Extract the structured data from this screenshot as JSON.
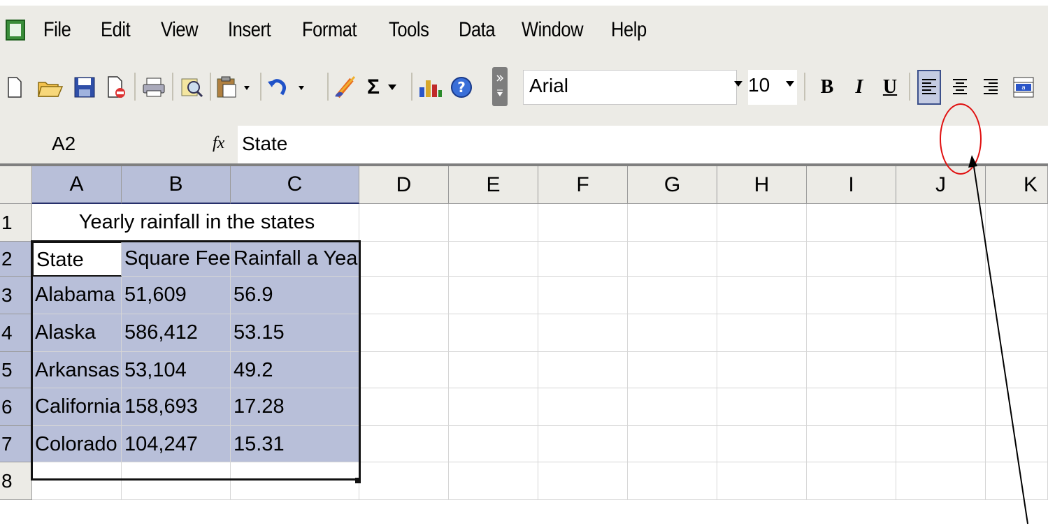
{
  "menu": [
    "File",
    "Edit",
    "View",
    "Insert",
    "Format",
    "Tools",
    "Data",
    "Window",
    "Help"
  ],
  "toolbar": {
    "font_name": "Arial",
    "font_size": "10",
    "bold": "B",
    "italic": "I",
    "underline": "U",
    "sigma": "Σ",
    "icons": [
      "new-icon",
      "open-icon",
      "save-icon",
      "permission-icon",
      "print-icon",
      "research-icon",
      "paste-icon",
      "undo-icon",
      "format-painter-icon",
      "autosum-icon",
      "chart-wizard-icon",
      "help-icon",
      "toolbar-options-icon",
      "align-left-icon",
      "center-icon",
      "align-right-icon",
      "merge-center-icon"
    ]
  },
  "formula_bar": {
    "name_box": "A2",
    "fx": "fx",
    "content": "State"
  },
  "columns": [
    "A",
    "B",
    "C",
    "D",
    "E",
    "F",
    "G",
    "H",
    "I",
    "J",
    "K"
  ],
  "rows": [
    "1",
    "2",
    "3",
    "4",
    "5",
    "6",
    "7",
    "8"
  ],
  "sheet": {
    "title": "Yearly rainfall in the states",
    "headers": [
      "State",
      "Square Feet",
      "Rainfall a Year"
    ],
    "data": [
      [
        "Alabama",
        "51,609",
        "56.9"
      ],
      [
        "Alaska",
        "586,412",
        "53.15"
      ],
      [
        "Arkansas",
        "53,104",
        "49.2"
      ],
      [
        "California",
        "158,693",
        "17.28"
      ],
      [
        "Colorado",
        "104,247",
        "15.31"
      ]
    ]
  },
  "colors": {
    "selection": "#b8bfd9",
    "annotation": "#e01010",
    "toolbar": "#ecebe6"
  }
}
